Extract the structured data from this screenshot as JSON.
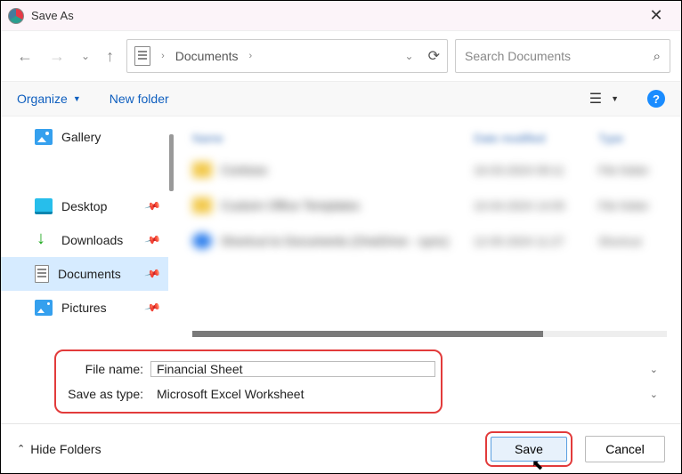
{
  "window": {
    "title": "Save As"
  },
  "nav": {
    "current_folder": "Documents",
    "search_placeholder": "Search Documents"
  },
  "toolbar": {
    "organize": "Organize",
    "new_folder": "New folder"
  },
  "sidebar": {
    "items": [
      {
        "label": "Gallery"
      },
      {
        "label": "Desktop"
      },
      {
        "label": "Downloads"
      },
      {
        "label": "Documents"
      },
      {
        "label": "Pictures"
      }
    ]
  },
  "filelist": {
    "headers": {
      "name": "Name",
      "date": "Date modified",
      "type": "Type"
    },
    "rows": [
      {
        "name": "Contoso",
        "date": "16-03-2024 09:11",
        "type": "File folder"
      },
      {
        "name": "Custom Office Templates",
        "date": "10-04-2024 14:05",
        "type": "File folder"
      },
      {
        "name": "Shortcut to Documents (OneDrive - sync)",
        "date": "12-05-2024 11:27",
        "type": "Shortcut"
      }
    ]
  },
  "form": {
    "file_name_label": "File name:",
    "file_name_value": "Financial Sheet",
    "save_type_label": "Save as type:",
    "save_type_value": "Microsoft Excel Worksheet"
  },
  "footer": {
    "hide_folders": "Hide Folders",
    "save": "Save",
    "cancel": "Cancel"
  }
}
